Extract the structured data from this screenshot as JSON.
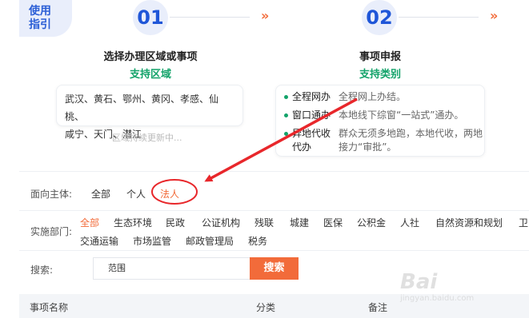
{
  "guide": {
    "badge_line1": "使用",
    "badge_line2": "指引"
  },
  "steps": [
    {
      "num": "01",
      "title": "选择办理区域或事项",
      "subtitle": "支持区域"
    },
    {
      "num": "02",
      "title": "事项申报",
      "subtitle": "支持类别"
    }
  ],
  "arrow_glyph": "»",
  "regions": {
    "line1": "武汉、黄石、鄂州、黄冈、孝感、仙桃、",
    "line2": "咸宁、天门、潜江",
    "note": "区域持续更新中..."
  },
  "categories": [
    {
      "name": "全程网办",
      "desc": "全程网上办结。"
    },
    {
      "name": "窗口通办",
      "desc": "本地线下综窗“一站式”通办。"
    },
    {
      "name": "异地代收代办",
      "desc": "群众无须多地跑，本地代收，两地接力“审批”。"
    }
  ],
  "filter": {
    "subject_label": "面向主体:",
    "subject_items": [
      {
        "label": "全部",
        "active": false
      },
      {
        "label": "个人",
        "active": false
      },
      {
        "label": "法人",
        "active": true
      }
    ],
    "dept_label": "实施部门:",
    "dept_items_row1": [
      "全部",
      "生态环境",
      "民政",
      "公证机构",
      "残联",
      "城建",
      "医保",
      "公积金",
      "人社",
      "自然资源和规划",
      "卫"
    ],
    "dept_items_row2": [
      "交通运输",
      "市场监管",
      "邮政管理局",
      "税务"
    ],
    "search_label": "搜索:",
    "search_value": "范围",
    "search_button": "搜索"
  },
  "table": {
    "headers": [
      "事项名称",
      "分类",
      "备注"
    ]
  },
  "colors": {
    "accent": "#f26b3a",
    "blue": "#1f56d8",
    "green": "#13a36a",
    "annotation": "#e8272b"
  },
  "watermark": {
    "text": "Bai",
    "sub": "jingyan.baidu.com"
  }
}
